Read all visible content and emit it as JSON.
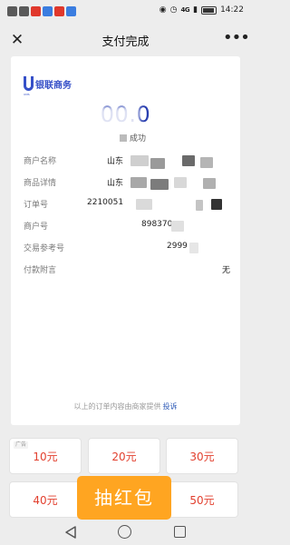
{
  "status_bar": {
    "network_label": "4G",
    "time": "14:22",
    "battery_icon": "battery-icon",
    "wifi_icon": "wifi-icon",
    "app_chip_colors": [
      "#5a5a5a",
      "#5a5a5a",
      "#e0382c",
      "#3b7de0",
      "#e0382c",
      "#3b7de0"
    ]
  },
  "nav": {
    "close_icon": "close-icon",
    "title": "支付完成",
    "more_icon": "more-icon"
  },
  "receipt": {
    "logo_text": "银联商务",
    "logo_sub": "UMS",
    "amount": "00.0",
    "status_text": "成功",
    "rows": [
      {
        "label": "商户名称",
        "value": "山东"
      },
      {
        "label": "商品详情",
        "value": "山东"
      },
      {
        "label": "订单号",
        "value": "2210051"
      },
      {
        "label": "商户号",
        "value": "898370"
      },
      {
        "label": "交易参考号",
        "value": "2999"
      },
      {
        "label": "付款附言",
        "value": "无"
      }
    ],
    "footer_note": "以上的订单内容由商家提供",
    "footer_link": "投诉"
  },
  "promo": {
    "ad_tag": "广告",
    "amounts": [
      "10元",
      "20元",
      "30元",
      "40元",
      "",
      "50元"
    ],
    "red_packet_label": "抽红包"
  },
  "colors": {
    "accent_blue": "#2a3fb0",
    "logo_blue": "#3650c8",
    "price_red": "#e2402f",
    "red_packet_orange": "#ffa521"
  },
  "system_nav": {
    "back_icon": "back-triangle-icon",
    "home_icon": "home-circle-icon",
    "recent_icon": "recent-square-icon"
  }
}
